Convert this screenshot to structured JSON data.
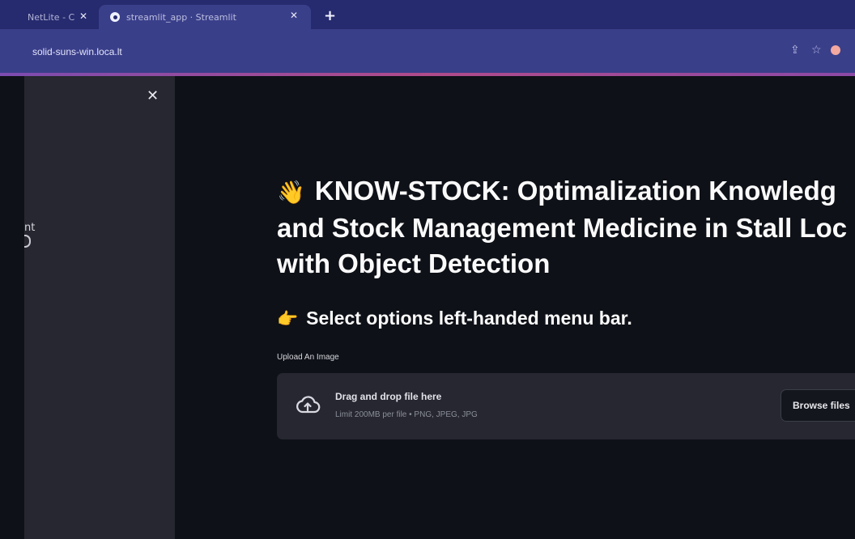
{
  "browser": {
    "tabs": [
      {
        "title": "NetLite - C",
        "close": "✕"
      },
      {
        "title": "streamlit_app · Streamlit",
        "close": "✕"
      }
    ],
    "new_tab": "+",
    "url": "solid-suns-win.loca.lt",
    "icons": [
      "share-icon",
      "star-icon",
      "extension-icon"
    ],
    "accent": "#262a6e"
  },
  "sidebar": {
    "close": "✕",
    "partial_text": "nt"
  },
  "main": {
    "title_emoji": "👋",
    "title": "KNOW-STOCK: Optimalization Knowledge and Stock Management Medicine in Stall Location with Object Detection",
    "title_lines": [
      "KNOW-STOCK: Optimalization Knowledg",
      "and Stock Management Medicine in Stall Loc",
      "with Object Detection"
    ],
    "subtitle_emoji": "👉",
    "subtitle": "Select options left-handed menu bar.",
    "uploader": {
      "label": "Upload An Image",
      "drag_text": "Drag and drop file here",
      "limit_text": "Limit 200MB per file • PNG, JPEG, JPG",
      "button_label": "Browse files",
      "icon": "cloud-upload-icon"
    }
  },
  "colors": {
    "background": "#0e1117",
    "sidebar": "#262730",
    "dropzone": "#262730"
  }
}
